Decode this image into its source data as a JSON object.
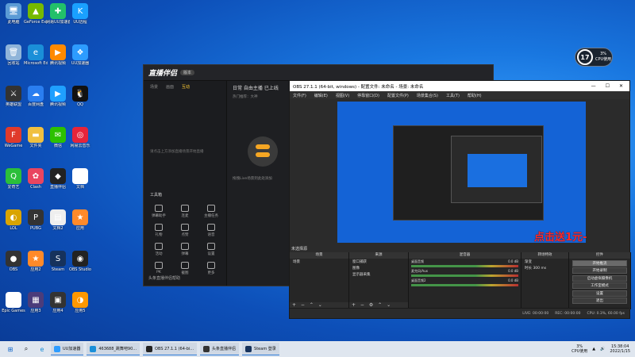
{
  "desktop": {
    "icons": [
      {
        "label": "此电脑",
        "color": "#5b9bd5",
        "glyph": "🖥"
      },
      {
        "label": "GeForce Experience",
        "color": "#76b900",
        "glyph": "▲"
      },
      {
        "label": "网易UU加速器",
        "color": "#22c06a",
        "glyph": "✚"
      },
      {
        "label": "UU远程",
        "color": "#1aa0ff",
        "glyph": "K"
      },
      {
        "label": "回收站",
        "color": "#8fb4d9",
        "glyph": "🗑"
      },
      {
        "label": "Microsoft Edge",
        "color": "#1a8fd8",
        "glyph": "e"
      },
      {
        "label": "腾讯视频",
        "color": "#ff8a00",
        "glyph": "▶"
      },
      {
        "label": "UU加速器",
        "color": "#2d9cff",
        "glyph": "❖"
      },
      {
        "label": "英雄联盟",
        "color": "#333",
        "glyph": "⚔"
      },
      {
        "label": "百度网盘",
        "color": "#2a7ef0",
        "glyph": "☁"
      },
      {
        "label": "腾讯视频",
        "color": "#1fa0ff",
        "glyph": "▶"
      },
      {
        "label": "QQ",
        "color": "#111",
        "glyph": "🐧"
      },
      {
        "label": "WeGame",
        "color": "#e03a2b",
        "glyph": "F"
      },
      {
        "label": "文件夹",
        "color": "#f0c040",
        "glyph": "▬"
      },
      {
        "label": "微信",
        "color": "#2dc100",
        "glyph": "✉"
      },
      {
        "label": "网易云音乐",
        "color": "#e6243a",
        "glyph": "◎"
      },
      {
        "label": "爱奇艺",
        "color": "#2bbf3a",
        "glyph": "Q"
      },
      {
        "label": "Clash",
        "color": "#e94560",
        "glyph": "✿"
      },
      {
        "label": "直播伴侣",
        "color": "#222",
        "glyph": "◆"
      },
      {
        "label": "文档",
        "color": "#fff",
        "glyph": "▤"
      },
      {
        "label": "LOL",
        "color": "#d9a400",
        "glyph": "◐"
      },
      {
        "label": "PUBG",
        "color": "#333",
        "glyph": "P"
      },
      {
        "label": "文档2",
        "color": "#eee",
        "glyph": "▤"
      },
      {
        "label": "应用",
        "color": "#ff8a2a",
        "glyph": "★"
      },
      {
        "label": "OBS",
        "color": "#333",
        "glyph": "●"
      },
      {
        "label": "应用2",
        "color": "#ff8a2a",
        "glyph": "★"
      },
      {
        "label": "Steam",
        "color": "#16325c",
        "glyph": "S"
      },
      {
        "label": "OBS Studio",
        "color": "#222",
        "glyph": "◉"
      },
      {
        "label": "Epic Games",
        "color": "#fff",
        "glyph": "E"
      },
      {
        "label": "应用3",
        "color": "#4b3c7a",
        "glyph": "▦"
      },
      {
        "label": "应用4",
        "color": "#333",
        "glyph": "▣"
      },
      {
        "label": "应用5",
        "color": "#ff9800",
        "glyph": "◑"
      }
    ]
  },
  "perf_widget": {
    "value": "17",
    "cpu_pct": "3%",
    "cpu_label": "CPU使用"
  },
  "zb_window": {
    "title": "直播伴侣",
    "badge": "版本",
    "tabs": [
      "场景",
      "画面",
      "互动"
    ],
    "hint": "请点击上方添加直播场景开始直播",
    "tools_title": "工具箱",
    "tools": [
      "弹幕助手",
      "连麦",
      "主播任务",
      "礼物",
      "点赞",
      "语音",
      "活动",
      "弹幕",
      "设置",
      "PK",
      "截图",
      "更多"
    ],
    "bottom_text": "头条直播伴侣帮助",
    "mid_title": "日常 自由主播 已上线",
    "mid_sub": "热门推荐：大神",
    "mid_empty": "拖拽Live场景到此处添加"
  },
  "obs": {
    "title": "OBS 27.1.1 (64-bit, windows) - 配置文件: 未命名 - 场景: 未命名",
    "menu": [
      "文件(F)",
      "编辑(E)",
      "视图(V)",
      "停靠窗口(D)",
      "配置文件(P)",
      "场景集合(S)",
      "工具(T)",
      "帮助(H)"
    ],
    "overlay_text": "点击送1元-",
    "selected_source": "未选择源",
    "panels": {
      "scenes": {
        "header": "场景",
        "items": [
          "场景"
        ]
      },
      "sources": {
        "header": "来源",
        "items": [
          "窗口捕获",
          "图像",
          "显示器采集"
        ]
      },
      "mixer": {
        "header": "混音器",
        "tracks": [
          {
            "name": "桌面音频",
            "db": "0.0 dB"
          },
          {
            "name": "麦克风/Aux",
            "db": "0.0 dB"
          },
          {
            "name": "桌面音频2",
            "db": "0.0 dB"
          }
        ]
      },
      "transitions": {
        "header": "转场特效",
        "type": "渐变",
        "duration_label": "时长",
        "duration": "300 ms"
      },
      "controls": {
        "header": "控件",
        "buttons": [
          "开始推流",
          "开始录制",
          "启动虚拟摄像机",
          "工作室模式",
          "设置",
          "退出"
        ]
      }
    },
    "status": [
      "LIVE: 00:00:00",
      "REC: 00:00:00",
      "CPU: 0.3%, 60.00 fps"
    ]
  },
  "taskbar": {
    "apps": [
      {
        "label": "UU加速器",
        "color": "#2d9cff"
      },
      {
        "label": "463688_跳舞吧90...",
        "color": "#1a8fd8"
      },
      {
        "label": "OBS 27.1.1 (64-bi...",
        "color": "#222"
      },
      {
        "label": "头条直播伴侣",
        "color": "#333"
      },
      {
        "label": "Steam 登录",
        "color": "#16325c"
      }
    ],
    "cpu_pct": "3%",
    "cpu_label": "CPU使用",
    "time": "15:38:04",
    "date": "2022/1/15"
  }
}
